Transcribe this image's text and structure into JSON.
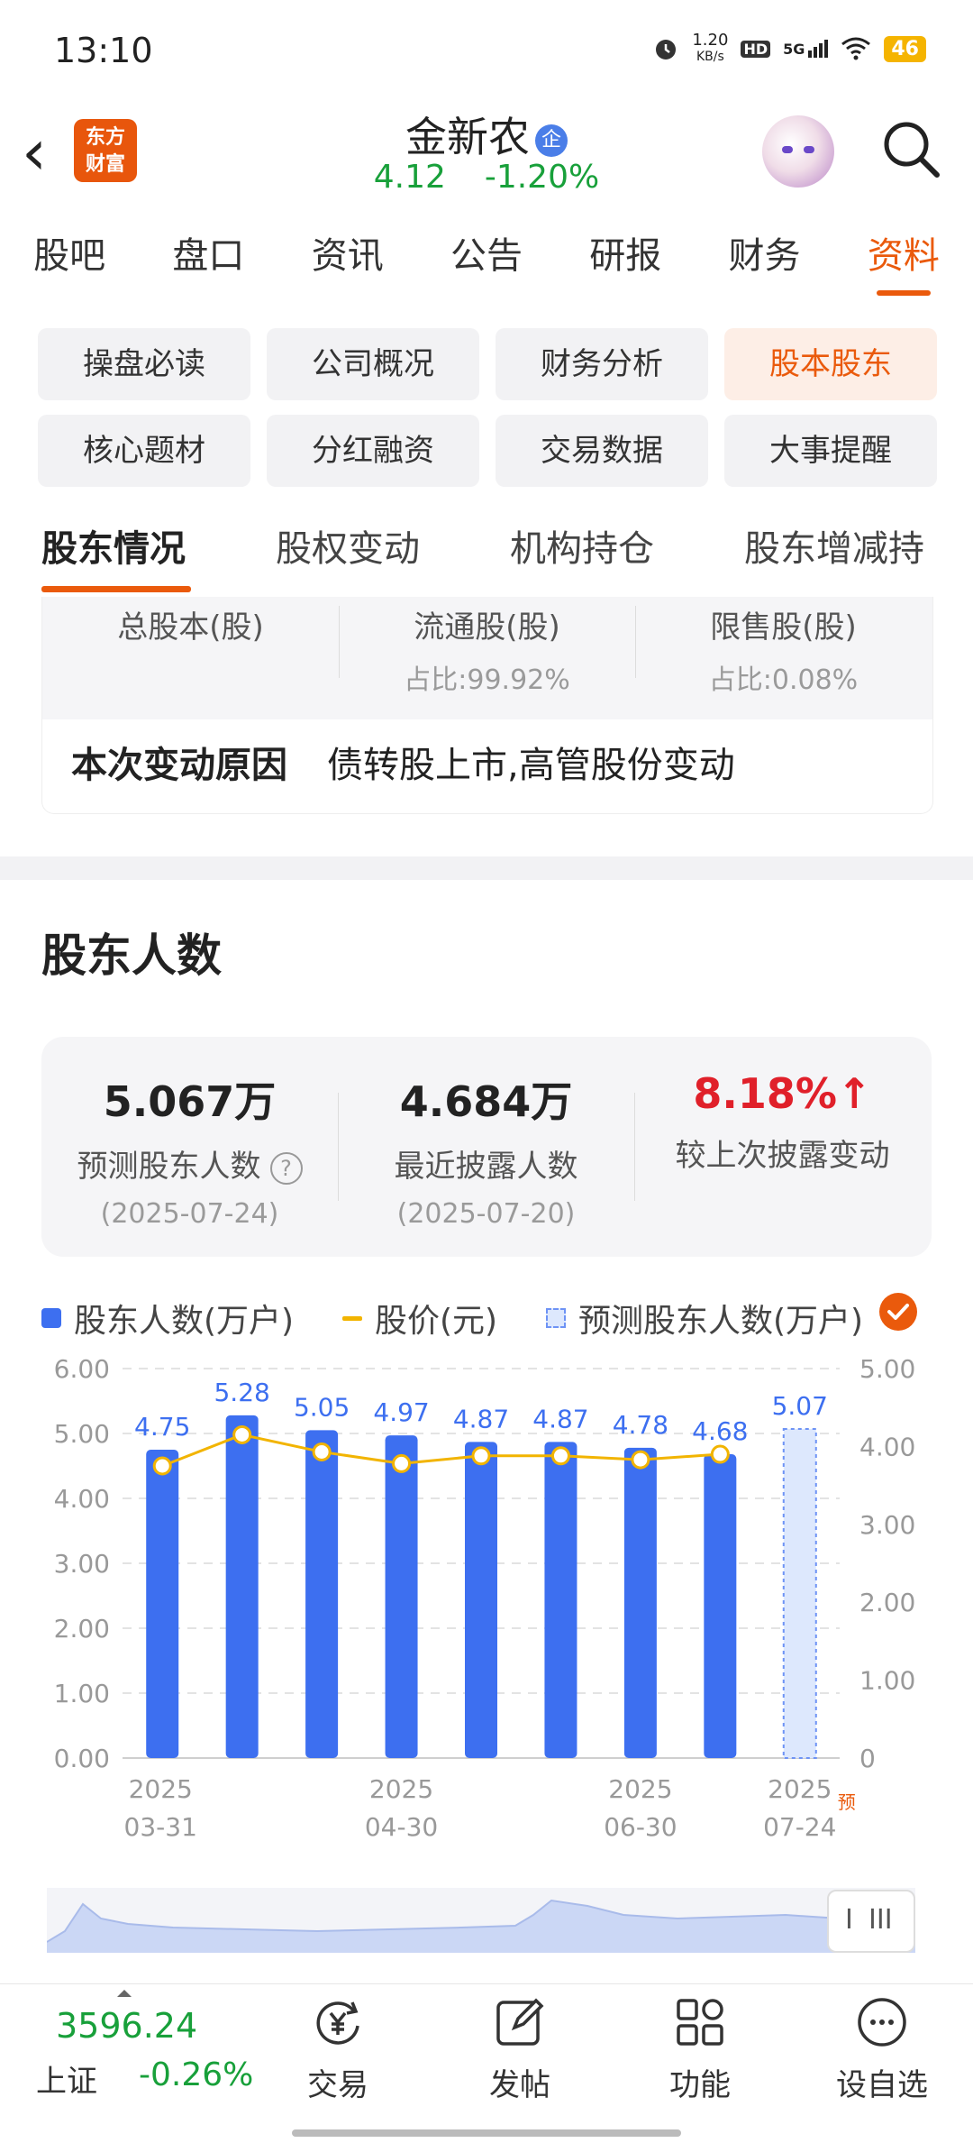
{
  "status_bar": {
    "time": "13:10",
    "net_speed_top": "1.20",
    "net_speed_unit": "KB/s",
    "hd": "HD",
    "signal": "5G",
    "battery": "46"
  },
  "header": {
    "back_symbol": "‹",
    "logo_line1": "东方",
    "logo_line2": "财富",
    "stock_name": "金新农",
    "badge": "企",
    "price": "4.12",
    "change_pct": "-1.20%"
  },
  "main_tabs": [
    {
      "label": "股吧"
    },
    {
      "label": "盘口"
    },
    {
      "label": "资讯"
    },
    {
      "label": "公告"
    },
    {
      "label": "研报"
    },
    {
      "label": "财务"
    },
    {
      "label": "资料"
    }
  ],
  "sub_chips": [
    {
      "label": "操盘必读"
    },
    {
      "label": "公司概况"
    },
    {
      "label": "财务分析"
    },
    {
      "label": "股本股东"
    },
    {
      "label": "核心题材"
    },
    {
      "label": "分红融资"
    },
    {
      "label": "交易数据"
    },
    {
      "label": "大事提醒"
    }
  ],
  "holder_tabs": [
    {
      "label": "股东情况"
    },
    {
      "label": "股权变动"
    },
    {
      "label": "机构持仓"
    },
    {
      "label": "股东增减持"
    }
  ],
  "share_capital": {
    "cols": [
      {
        "label": "总股本(股)",
        "sub": ""
      },
      {
        "label": "流通股(股)",
        "sub": "占比:99.92%"
      },
      {
        "label": "限售股(股)",
        "sub": "占比:0.08%"
      }
    ],
    "reason_label": "本次变动原因",
    "reason_value": "债转股上市,高管股份变动"
  },
  "holders_section": {
    "title": "股东人数",
    "stats": [
      {
        "value": "5.067万",
        "label": "预测股东人数",
        "date": "(2025-07-24)"
      },
      {
        "value": "4.684万",
        "label": "最近披露人数",
        "date": "(2025-07-20)"
      },
      {
        "value": "8.18%",
        "label": "较上次披露变动",
        "date": ""
      }
    ],
    "help_icon": "?",
    "up_arrow": "↑"
  },
  "legend": {
    "bars": "股东人数(万户)",
    "line": "股价(元)",
    "forecast": "预测股东人数(万户)"
  },
  "colors": {
    "accent": "#ea5a0c",
    "bar": "#3d6ff0",
    "line": "#f2b400",
    "up": "#e0202a",
    "down": "#18a03a"
  },
  "chart_data": {
    "type": "bar",
    "categories": [
      "2025-03-31",
      "",
      "",
      "2025-04-30",
      "",
      "",
      "2025-06-30",
      "",
      "2025-07-24"
    ],
    "x_tick_labels": [
      {
        "year": "2025",
        "date": "03-31",
        "index": 0
      },
      {
        "year": "2025",
        "date": "04-30",
        "index": 3
      },
      {
        "year": "2025",
        "date": "06-30",
        "index": 6
      },
      {
        "year": "2025",
        "date": "07-24",
        "index": 8
      }
    ],
    "forecast_mark": "预",
    "series": [
      {
        "name": "股东人数(万户)",
        "values": [
          4.75,
          5.28,
          5.05,
          4.97,
          4.87,
          4.87,
          4.78,
          4.68,
          null
        ]
      },
      {
        "name": "预测股东人数(万户)",
        "values": [
          null,
          null,
          null,
          null,
          null,
          null,
          null,
          null,
          5.07
        ]
      },
      {
        "name": "股价(元)",
        "values": [
          3.75,
          4.15,
          3.93,
          3.78,
          3.88,
          3.88,
          3.83,
          3.9,
          null
        ]
      }
    ],
    "y_left": {
      "ticks": [
        "6.00",
        "5.00",
        "4.00",
        "3.00",
        "2.00",
        "1.00",
        "0.00"
      ],
      "ylim": [
        0,
        6
      ]
    },
    "y_right": {
      "ticks": [
        "5.00",
        "4.00",
        "3.00",
        "2.00",
        "1.00",
        "0"
      ],
      "ylim": [
        0,
        5
      ]
    },
    "grid": true
  },
  "scroll_handle": {
    "left_mark": "I",
    "right_mark": "III"
  },
  "bottom_bar": {
    "index_value": "3596.24",
    "index_name": "上证",
    "index_pct": "-0.26%",
    "items": [
      {
        "label": "交易",
        "icon": "yen-icon"
      },
      {
        "label": "发帖",
        "icon": "edit-icon"
      },
      {
        "label": "功能",
        "icon": "grid-icon"
      },
      {
        "label": "设自选",
        "icon": "more-icon"
      }
    ]
  }
}
